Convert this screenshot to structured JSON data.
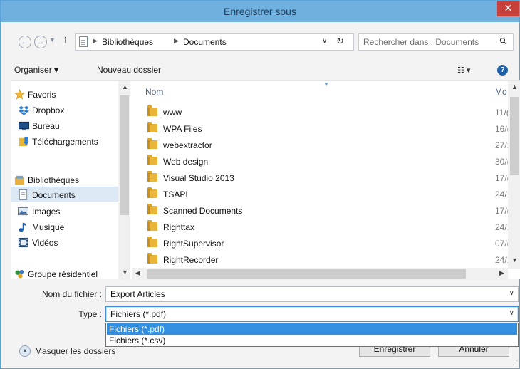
{
  "window": {
    "title": "Enregistrer sous",
    "close_glyph": "✕"
  },
  "address_bar": {
    "back_glyph": "←",
    "forward_glyph": "→",
    "dropdown_glyph": "▼",
    "up_glyph": "↑",
    "breadcrumb": [
      "Bibliothèques",
      "Documents"
    ],
    "separator_glyph": "▶",
    "history_glyph": "∨",
    "refresh_glyph": "↻",
    "search_placeholder": "Rechercher dans : Documents",
    "search_glyph": "⚲"
  },
  "toolbar": {
    "organize_label": "Organiser ▾",
    "new_folder_label": "Nouveau dossier",
    "view_glyph": "☷ ▾",
    "help_glyph": "?"
  },
  "nav_pane": {
    "items": [
      {
        "label": "Favoris",
        "icon": "star-icon",
        "color": "#f2b632"
      },
      {
        "label": "Dropbox",
        "icon": "dropbox-icon",
        "color": "#2e7ed6"
      },
      {
        "label": "Bureau",
        "icon": "desktop-icon",
        "color": "#1f4e88"
      },
      {
        "label": "Téléchargements",
        "icon": "downloads-icon",
        "color": "#2f7fd0"
      },
      {
        "label": "Bibliothèques",
        "icon": "libraries-icon",
        "color": "#e7b044"
      },
      {
        "label": "Documents",
        "icon": "document-icon",
        "color": "#7c8aa0",
        "selected": true
      },
      {
        "label": "Images",
        "icon": "pictures-icon",
        "color": "#3d6ea8"
      },
      {
        "label": "Musique",
        "icon": "music-icon",
        "color": "#2060b0"
      },
      {
        "label": "Vidéos",
        "icon": "videos-icon",
        "color": "#1e3f66"
      },
      {
        "label": "Groupe résidentiel",
        "icon": "homegroup-icon",
        "color": "#2f8f3a"
      }
    ]
  },
  "file_list": {
    "columns": [
      "Nom",
      "Mo"
    ],
    "rows": [
      {
        "name": "www",
        "date": "11/("
      },
      {
        "name": "WPA Files",
        "date": "16/("
      },
      {
        "name": "webextractor",
        "date": "27/1"
      },
      {
        "name": "Web design",
        "date": "30/("
      },
      {
        "name": "Visual Studio 2013",
        "date": "17/("
      },
      {
        "name": "TSAPI",
        "date": "24/1"
      },
      {
        "name": "Scanned Documents",
        "date": "17/("
      },
      {
        "name": "Righttax",
        "date": "24/1"
      },
      {
        "name": "RightSupervisor",
        "date": "07/("
      },
      {
        "name": "RightRecorder",
        "date": "24/1"
      }
    ]
  },
  "form": {
    "filename_label": "Nom du fichier :",
    "filename_value": "Export Articles",
    "type_label": "Type :",
    "type_value": "Fichiers (*.pdf)",
    "type_options": [
      "Fichiers (*.pdf)",
      "Fichiers (*.csv)"
    ],
    "selected_type_index": 0,
    "chevron_glyph": "∨"
  },
  "footer": {
    "hide_folders_label": "Masquer les dossiers",
    "save_label": "Enregistrer",
    "cancel_label": "Annuler"
  },
  "colors": {
    "titlebar": "#6fb0df",
    "close_button": "#c8403a",
    "selection": "#3390e0",
    "nav_selected": "#dce9f5",
    "folder": "#e9b63a"
  }
}
